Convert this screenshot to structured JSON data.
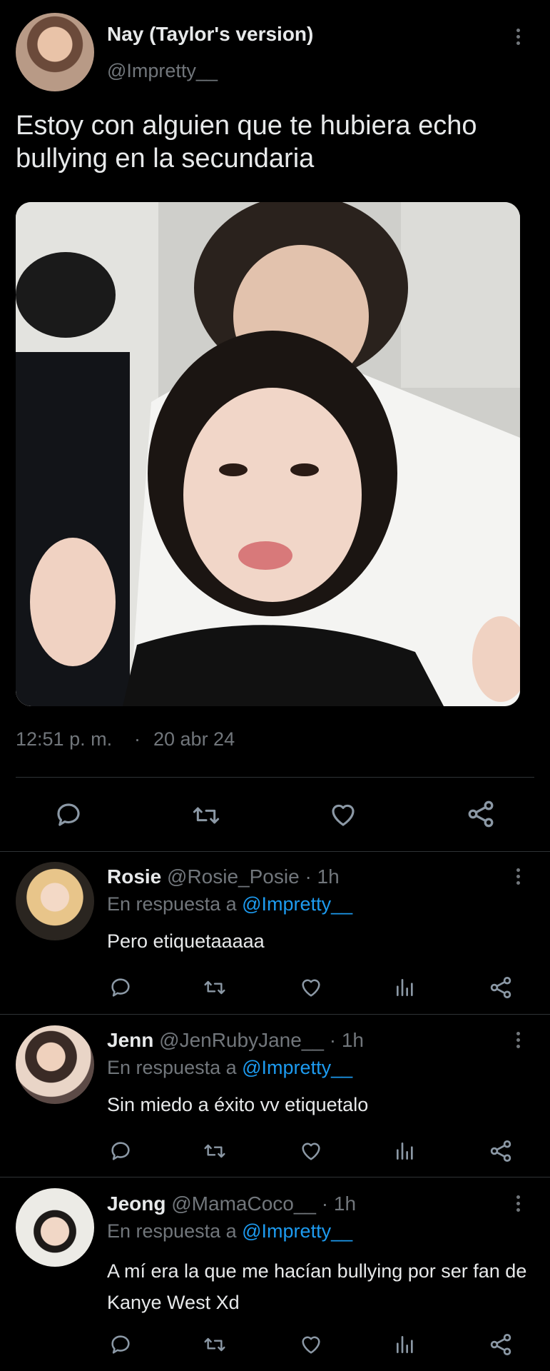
{
  "main_tweet": {
    "display_name": "Nay (Taylor's version)",
    "handle": "@Impretty__",
    "text": "Estoy con alguien que te hubiera echo bullying en la secundaria",
    "time": "12:51 p. m.",
    "separator": "·",
    "date": "20 abr 24"
  },
  "replies": [
    {
      "display_name": "Rosie",
      "handle": "@Rosie_Posie",
      "time": "· 1h",
      "reply_prefix": "En respuesta a",
      "reply_to": "@Impretty__",
      "text": "Pero etiquetaaaaa"
    },
    {
      "display_name": "Jenn",
      "handle": "@JenRubyJane__",
      "time": "· 1h",
      "reply_prefix": "En respuesta a",
      "reply_to": "@Impretty__",
      "text": "Sin miedo a éxito vv etiquetalo"
    },
    {
      "display_name": "Jeong",
      "handle": "@MamaCoco__",
      "time": "· 1h",
      "reply_prefix": "En respuesta a",
      "reply_to": "@Impretty__",
      "text": "A mí era la que me hacían bullying por ser fan de Kanye West Xd"
    }
  ],
  "colors": {
    "background": "#000000",
    "text": "#e7e9ea",
    "muted": "#71767b",
    "link": "#1d9bf0",
    "divider": "#2f3336"
  },
  "icons": [
    "more-icon",
    "reply-icon",
    "retweet-icon",
    "like-icon",
    "share-icon",
    "analytics-icon"
  ]
}
